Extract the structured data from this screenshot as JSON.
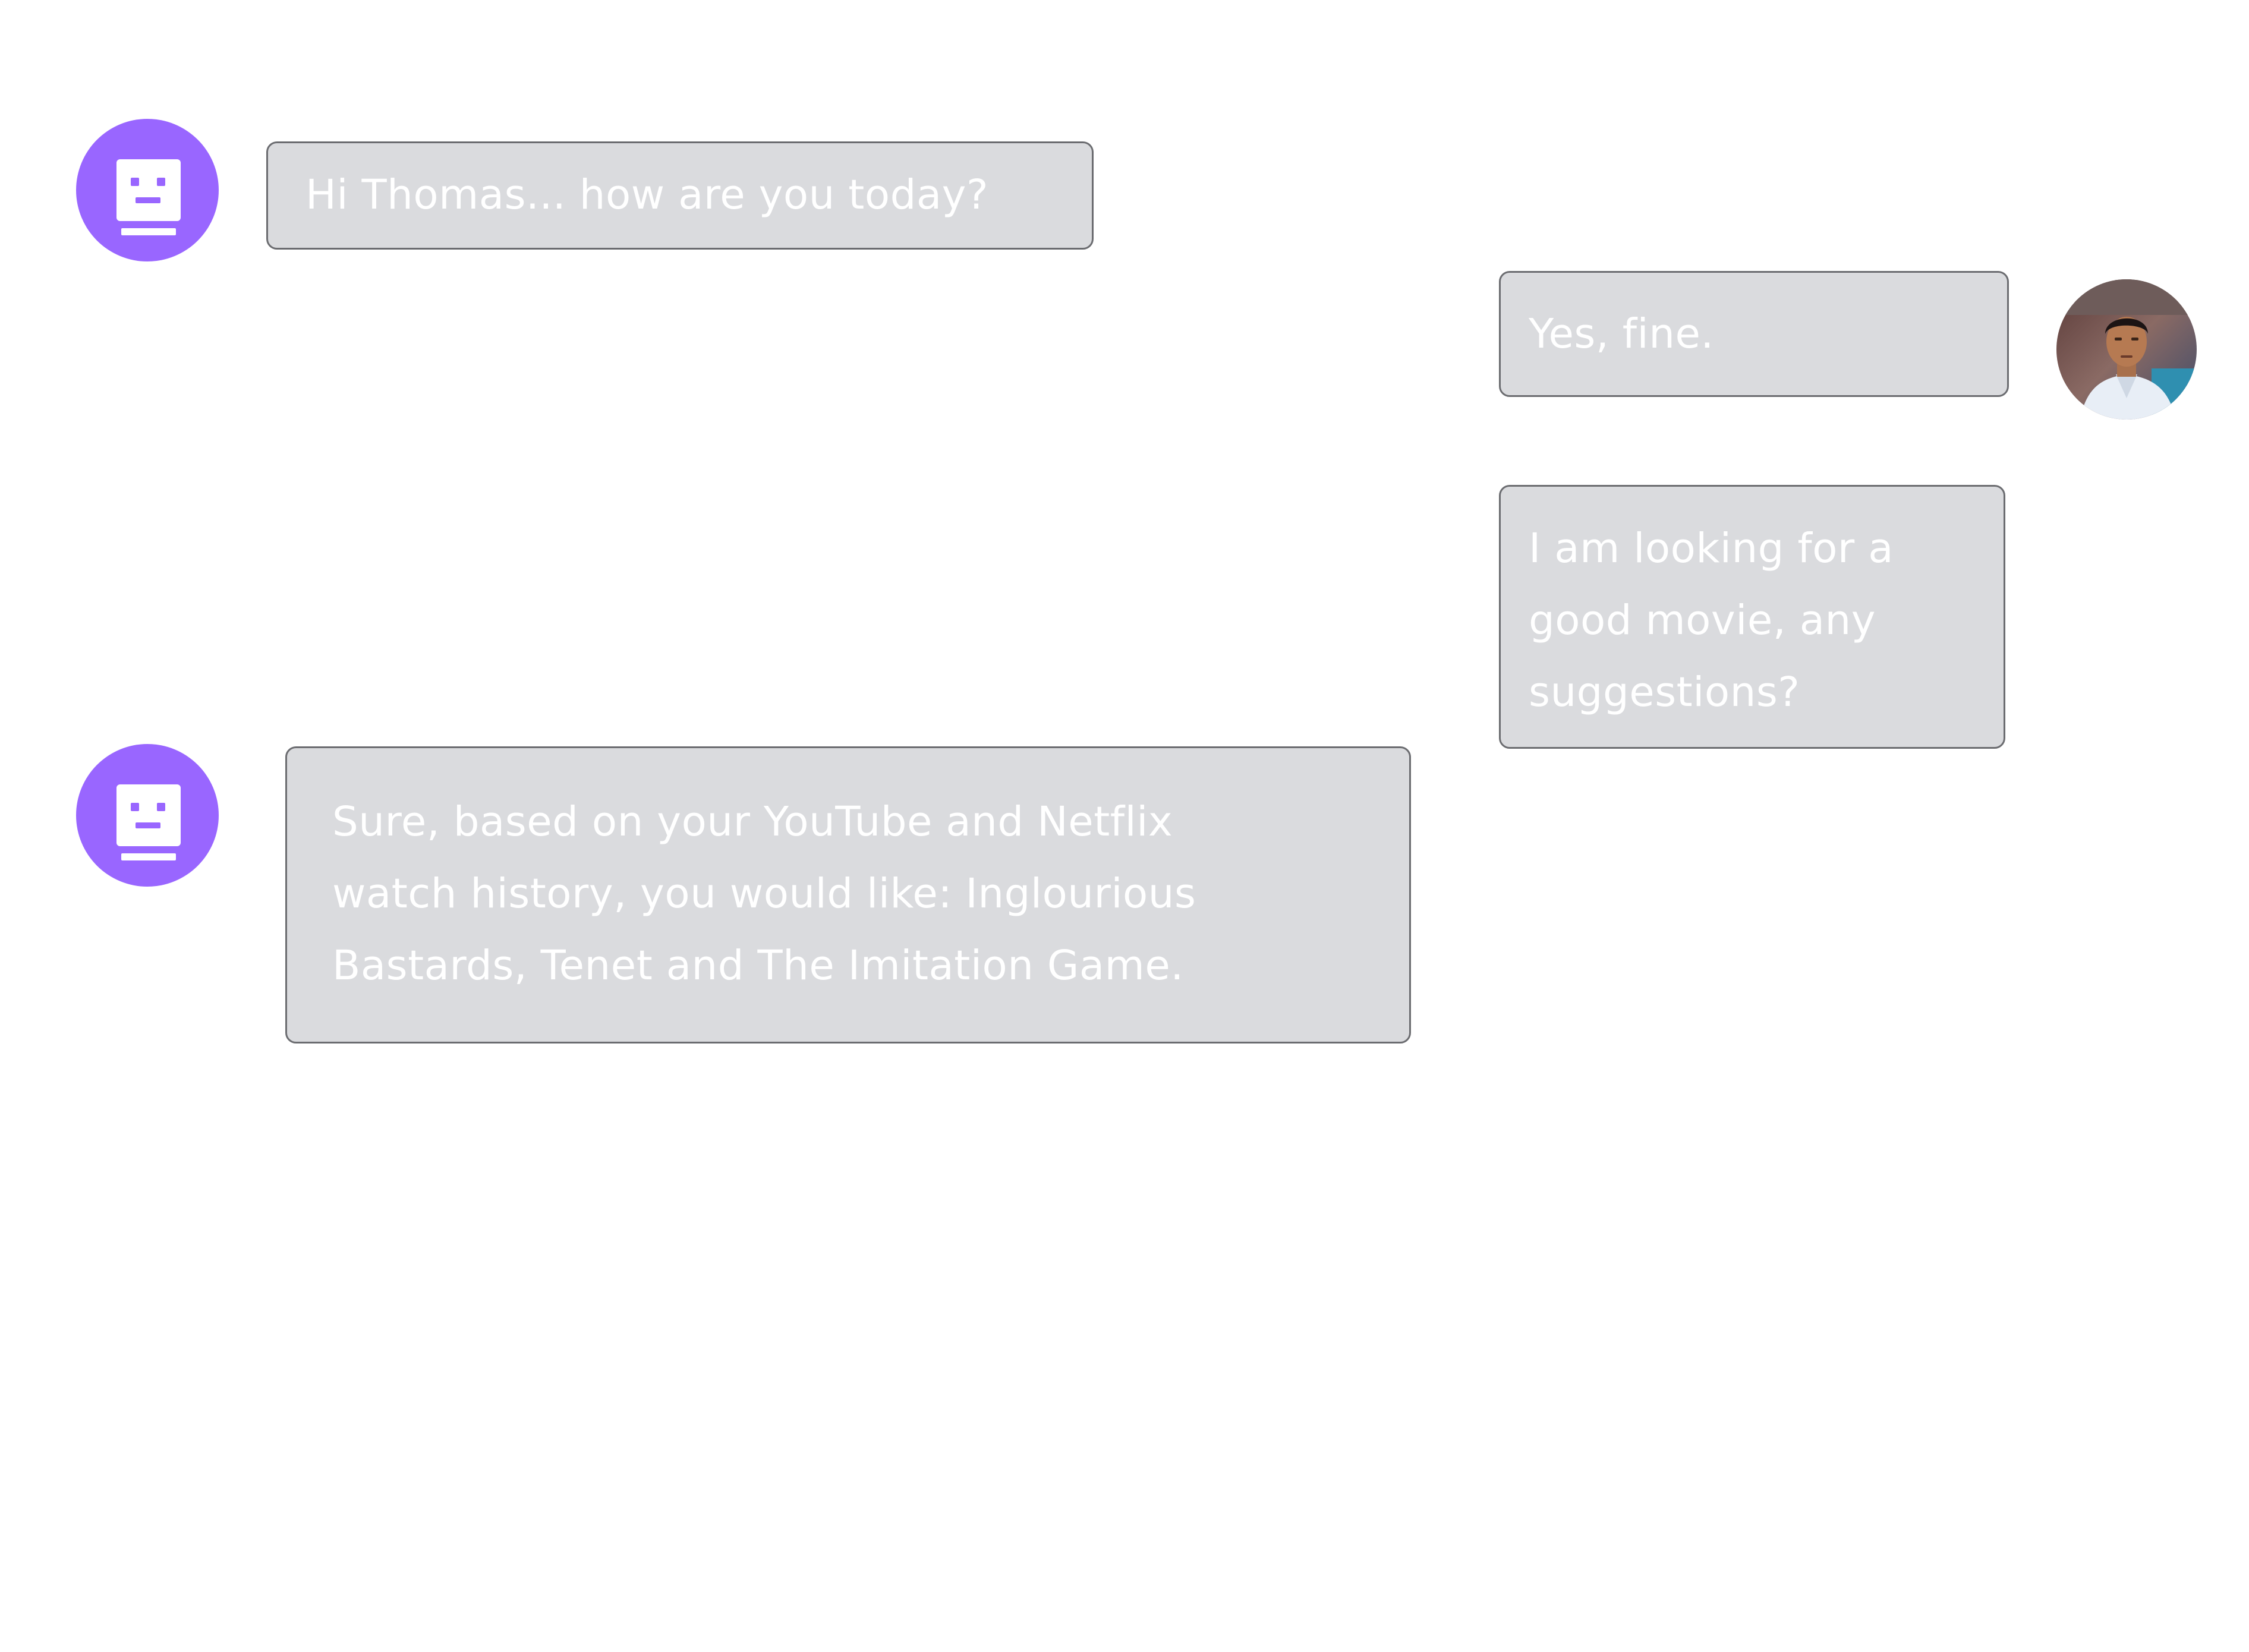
{
  "chat": {
    "messages": [
      {
        "sender": "bot",
        "avatar_icon": "robot-face-icon",
        "lines": [
          "Hi Thomas... how are you today?"
        ]
      },
      {
        "sender": "user",
        "avatar_icon": "user-photo-avatar",
        "lines": [
          "Yes, fine."
        ]
      },
      {
        "sender": "user",
        "lines": [
          "I am looking for a",
          "good movie, any",
          "suggestions?"
        ]
      },
      {
        "sender": "bot",
        "avatar_icon": "robot-face-icon",
        "lines": [
          "Sure, based on your YouTube and Netflix",
          "watch history, you would like: Inglourious",
          "Bastards, Tenet and The Imitation Game."
        ]
      }
    ]
  },
  "colors": {
    "bot_avatar": "#9966ff",
    "bubble_fill": "#dadbde",
    "bubble_border": "#6b6c70",
    "bubble_text": "#ffffff",
    "background": "#ffffff"
  }
}
